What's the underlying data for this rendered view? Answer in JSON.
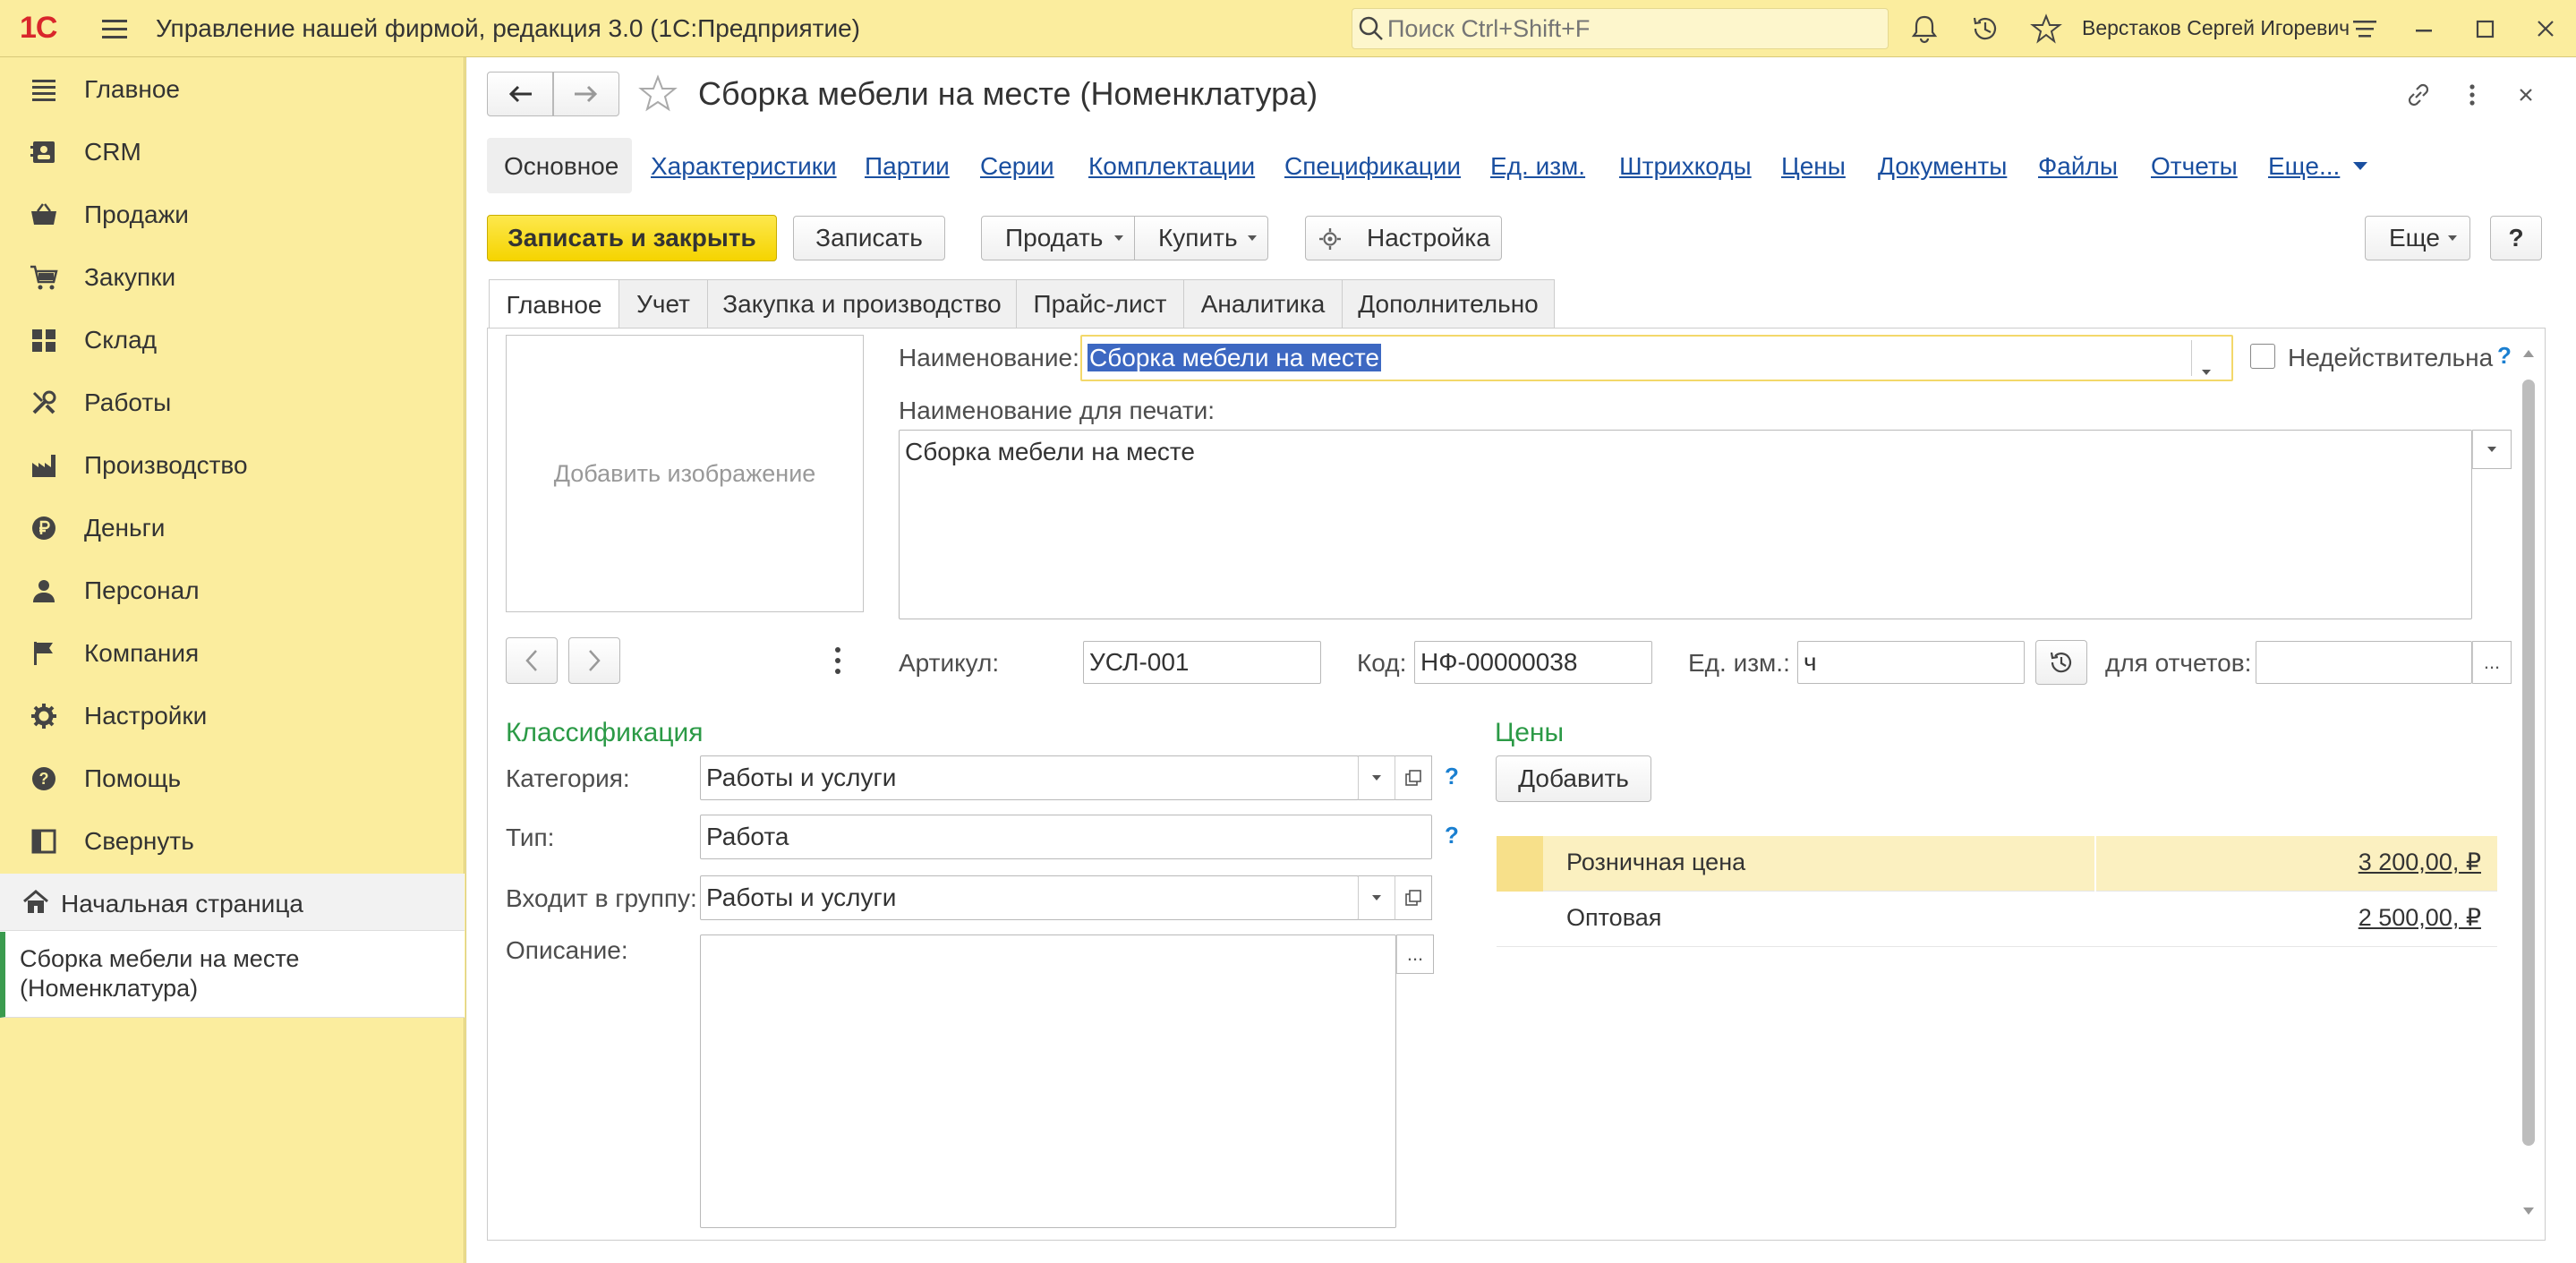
{
  "titlebar": {
    "logo": "1С",
    "title": "Управление нашей фирмой, редакция 3.0  (1С:Предприятие)",
    "search_placeholder": "Поиск Ctrl+Shift+F",
    "user": "Верстаков Сергей Игоревич",
    "icons": [
      "bell-icon",
      "history-icon",
      "star-icon",
      "settings-menu-icon",
      "minimize-icon",
      "maximize-icon",
      "close-icon"
    ]
  },
  "sidebar": {
    "items": [
      {
        "label": "Главное",
        "icon": "menu-lines-icon"
      },
      {
        "label": "CRM",
        "icon": "contacts-icon"
      },
      {
        "label": "Продажи",
        "icon": "basket-icon"
      },
      {
        "label": "Закупки",
        "icon": "cart-icon"
      },
      {
        "label": "Склад",
        "icon": "warehouse-icon"
      },
      {
        "label": "Работы",
        "icon": "tools-icon"
      },
      {
        "label": "Производство",
        "icon": "factory-icon"
      },
      {
        "label": "Деньги",
        "icon": "ruble-icon"
      },
      {
        "label": "Персонал",
        "icon": "person-icon"
      },
      {
        "label": "Компания",
        "icon": "flag-icon"
      },
      {
        "label": "Настройки",
        "icon": "gear-icon"
      },
      {
        "label": "Помощь",
        "icon": "help-icon"
      },
      {
        "label": "Свернуть",
        "icon": "collapse-icon"
      }
    ],
    "history": {
      "home": "Начальная страница",
      "current": "Сборка мебели на месте (Номенклатура)"
    }
  },
  "form": {
    "title": "Сборка мебели на месте (Номенклатура)",
    "nav_links": {
      "active": "Основное",
      "links": [
        "Характеристики",
        "Партии",
        "Серии",
        "Комплектации",
        "Спецификации",
        "Ед. изм.",
        "Штрихкоды",
        "Цены",
        "Документы",
        "Файлы",
        "Отчеты",
        "Еще..."
      ]
    },
    "toolbar": {
      "save_close": "Записать и закрыть",
      "save": "Записать",
      "sell": "Продать",
      "buy": "Купить",
      "settings": "Настройка",
      "more": "Еще",
      "help": "?"
    },
    "tabs": [
      "Главное",
      "Учет",
      "Закупка и производство",
      "Прайс-лист",
      "Аналитика",
      "Дополнительно"
    ],
    "image_placeholder": "Добавить изображение",
    "name_label": "Наименование:",
    "name_value": "Сборка мебели на месте",
    "inactive_label": "Недействительна",
    "inactive_checked": false,
    "print_name_label": "Наименование для печати:",
    "print_name_value": "Сборка мебели на месте",
    "article_label": "Артикул:",
    "article_value": "УСЛ-001",
    "code_label": "Код:",
    "code_value": "НФ-00000038",
    "unit_label": "Ед. изм.:",
    "unit_value": "ч",
    "reports_label": "для отчетов:",
    "reports_value": "",
    "classification": {
      "title": "Классификация",
      "category_label": "Категория:",
      "category_value": "Работы и услуги",
      "type_label": "Тип:",
      "type_value": "Работа",
      "group_label": "Входит в группу:",
      "group_value": "Работы и услуги",
      "description_label": "Описание:",
      "description_value": ""
    },
    "prices": {
      "title": "Цены",
      "add_button": "Добавить",
      "rows": [
        {
          "name": "Розничная цена",
          "value": "3 200,00, ₽"
        },
        {
          "name": "Оптовая",
          "value": "2 500,00, ₽"
        }
      ]
    },
    "help_mark": "?",
    "ellipsis": "..."
  }
}
